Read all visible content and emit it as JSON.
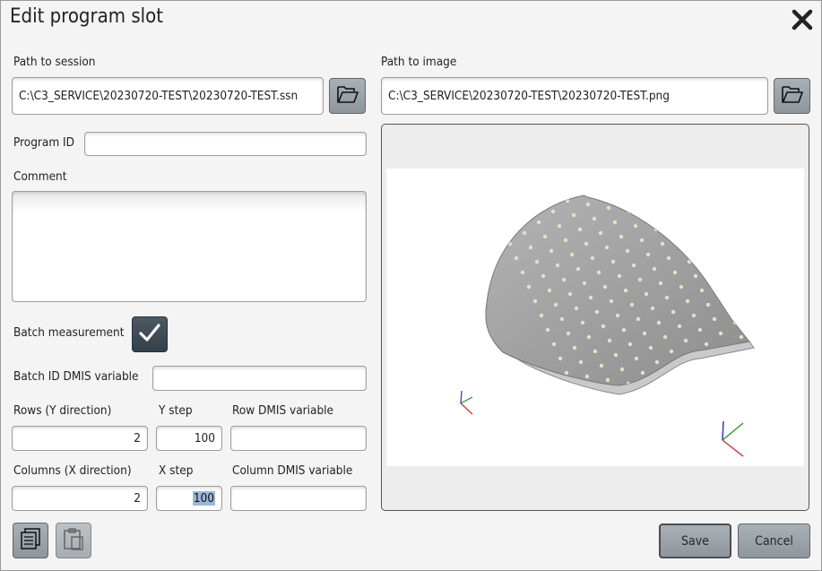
{
  "dialog": {
    "title": "Edit program slot",
    "close_icon": "close-icon"
  },
  "session": {
    "label": "Path to session",
    "value": "C:\\C3_SERVICE\\20230720-TEST\\20230720-TEST.ssn",
    "browse_icon": "folder-open-icon"
  },
  "image": {
    "label": "Path to image",
    "value": "C:\\C3_SERVICE\\20230720-TEST\\20230720-TEST.png",
    "browse_icon": "folder-open-icon"
  },
  "program_id": {
    "label": "Program ID",
    "value": ""
  },
  "comment": {
    "label": "Comment",
    "value": ""
  },
  "batch": {
    "label": "Batch measurement",
    "checked": true
  },
  "batch_id": {
    "label": "Batch ID DMIS variable",
    "value": ""
  },
  "rows": {
    "label": "Rows (Y direction)",
    "value": "2",
    "step_label": "Y step",
    "step_value": "100",
    "var_label": "Row DMIS variable",
    "var_value": ""
  },
  "columns": {
    "label": "Columns (X direction)",
    "value": "2",
    "step_label": "X step",
    "step_value": "100",
    "var_label": "Column DMIS variable",
    "var_value": ""
  },
  "footer": {
    "save_label": "Save",
    "cancel_label": "Cancel",
    "copy_icon": "copy-icon",
    "paste_icon": "paste-icon"
  },
  "colors": {
    "button": "#9aa2a8",
    "checkbox": "#3d4a53",
    "part": "#9c9c9c",
    "dots": "#e3e2c6"
  }
}
